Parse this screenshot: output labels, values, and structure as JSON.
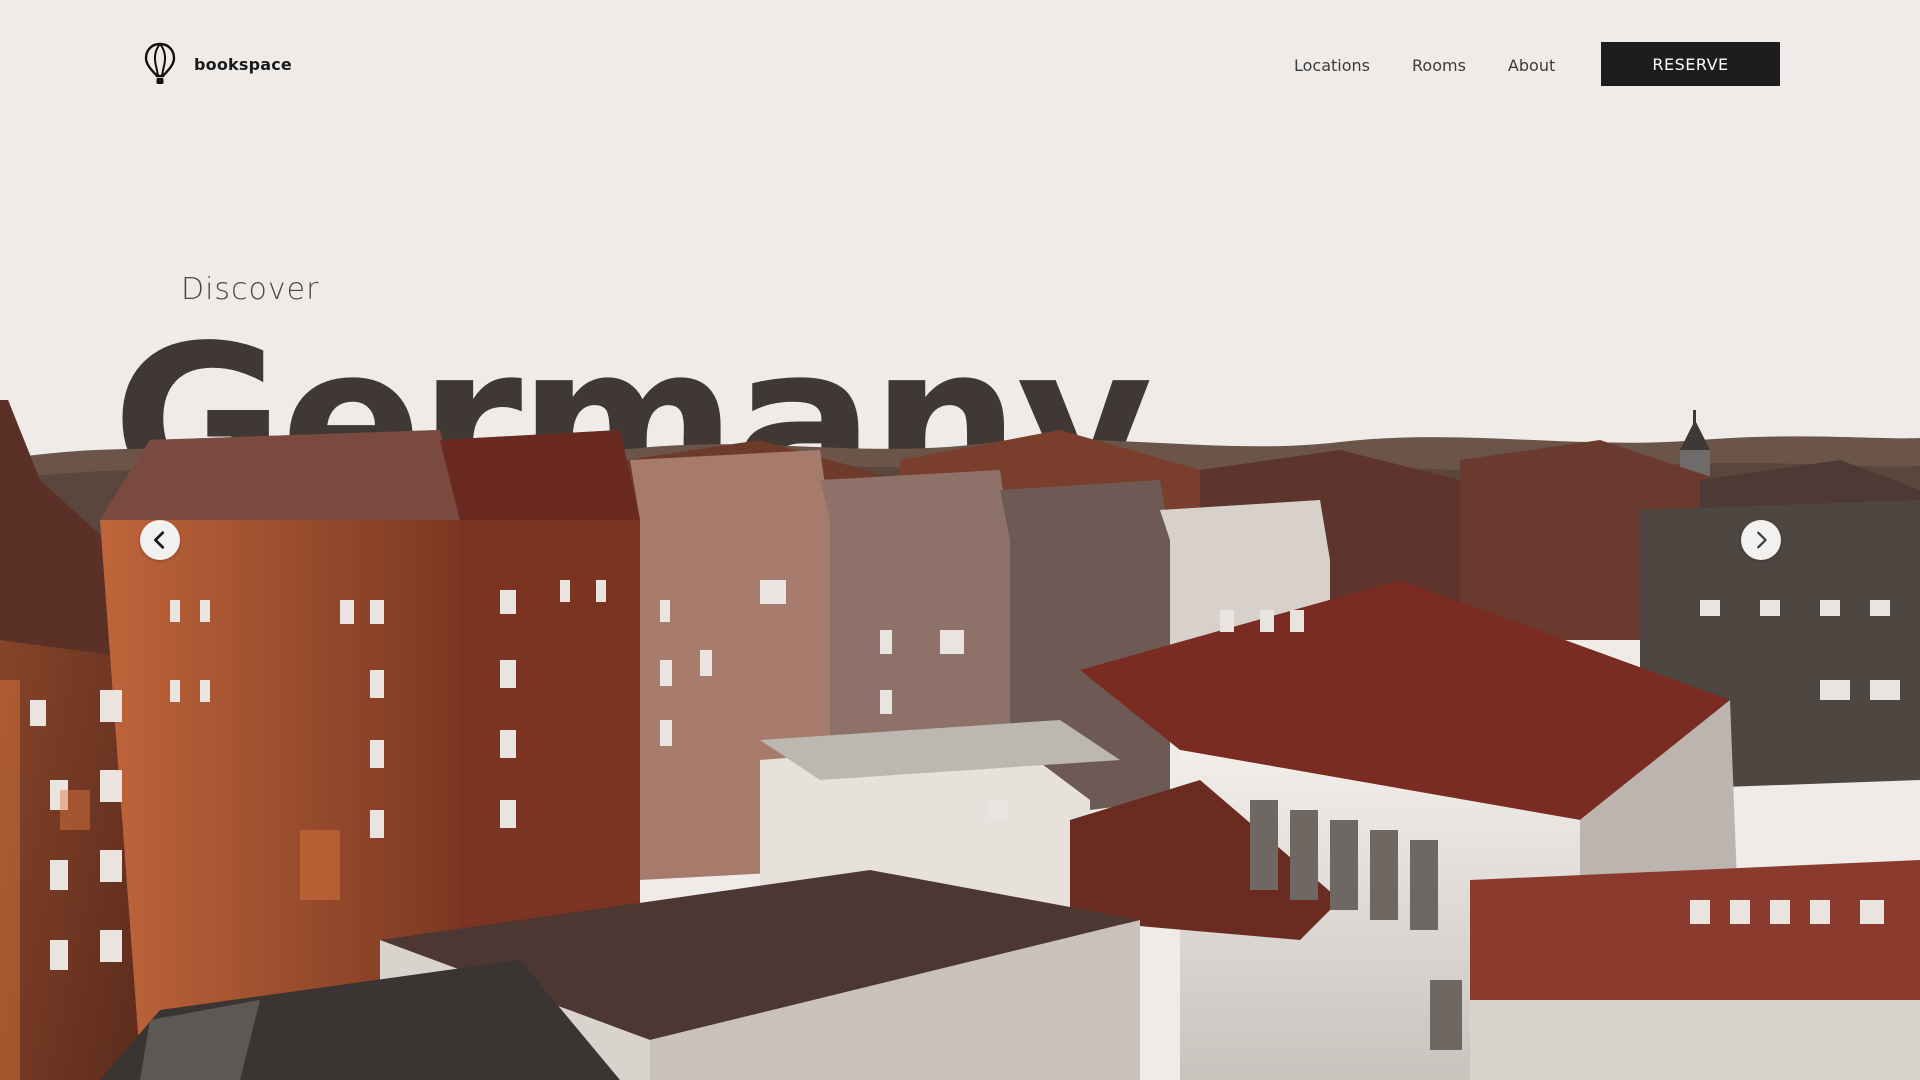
{
  "brand": {
    "name": "bookspace",
    "icon": "hot-air-balloon-icon"
  },
  "nav": {
    "items": [
      {
        "label": "Locations"
      },
      {
        "label": "Rooms"
      },
      {
        "label": "About"
      }
    ],
    "cta": "RESERVE"
  },
  "hero": {
    "eyebrow": "Discover",
    "title": "Germany",
    "prev_icon": "chevron-left-icon",
    "next_icon": "chevron-right-icon"
  },
  "colors": {
    "background": "#efebe8",
    "title": "#3f3834",
    "cta_bg": "#1d1d1f",
    "cta_text": "#ffffff",
    "brick": "#8c3e26",
    "roof": "#6e2a22"
  }
}
